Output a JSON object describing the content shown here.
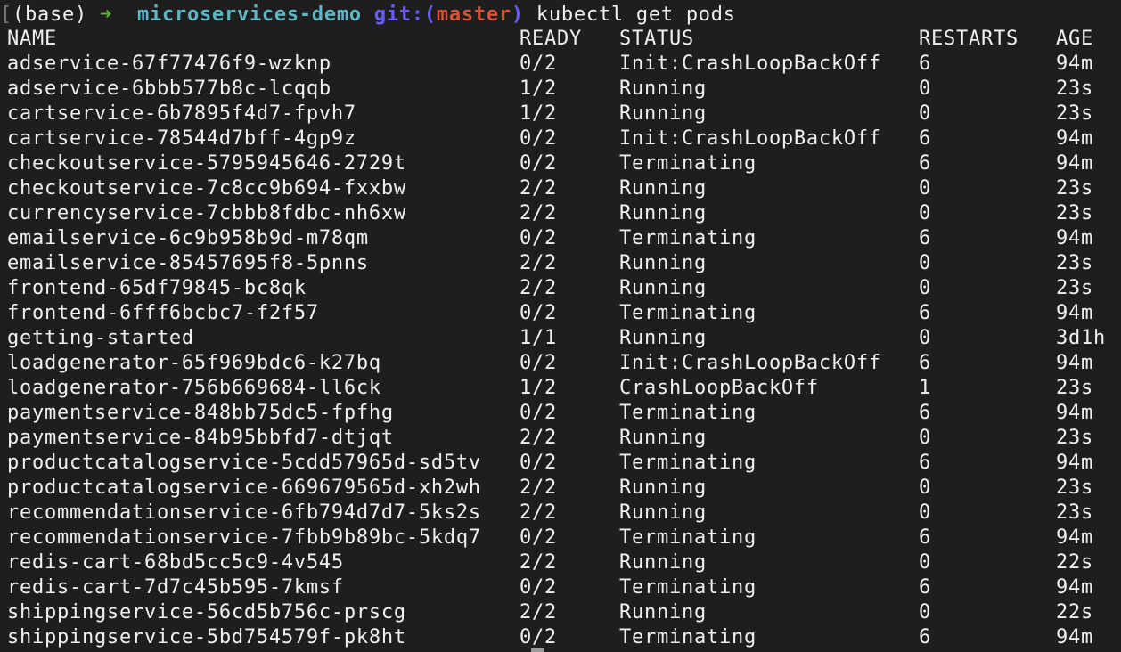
{
  "prompt": {
    "bracket": "[",
    "env": "(base)",
    "arrow": "➜",
    "directory": "microservices-demo",
    "git_prefix": "git:(",
    "branch": "master",
    "git_suffix": ")",
    "command": "kubectl get pods"
  },
  "colors": {
    "background": "#1e1e1e",
    "text": "#f0f0f0",
    "arrow": "#5fb236",
    "directory": "#5fb6c4",
    "git": "#6a5cff",
    "branch": "#d6533a"
  },
  "table": {
    "headers": [
      "NAME",
      "READY",
      "STATUS",
      "RESTARTS",
      "AGE"
    ],
    "rows": [
      [
        "adservice-67f77476f9-wzknp",
        "0/2",
        "Init:CrashLoopBackOff",
        "6",
        "94m"
      ],
      [
        "adservice-6bbb577b8c-lcqqb",
        "1/2",
        "Running",
        "0",
        "23s"
      ],
      [
        "cartservice-6b7895f4d7-fpvh7",
        "1/2",
        "Running",
        "0",
        "23s"
      ],
      [
        "cartservice-78544d7bff-4gp9z",
        "0/2",
        "Init:CrashLoopBackOff",
        "6",
        "94m"
      ],
      [
        "checkoutservice-5795945646-2729t",
        "0/2",
        "Terminating",
        "6",
        "94m"
      ],
      [
        "checkoutservice-7c8cc9b694-fxxbw",
        "2/2",
        "Running",
        "0",
        "23s"
      ],
      [
        "currencyservice-7cbbb8fdbc-nh6xw",
        "2/2",
        "Running",
        "0",
        "23s"
      ],
      [
        "emailservice-6c9b958b9d-m78qm",
        "0/2",
        "Terminating",
        "6",
        "94m"
      ],
      [
        "emailservice-85457695f8-5pnns",
        "2/2",
        "Running",
        "0",
        "23s"
      ],
      [
        "frontend-65df79845-bc8qk",
        "2/2",
        "Running",
        "0",
        "23s"
      ],
      [
        "frontend-6fff6bcbc7-f2f57",
        "0/2",
        "Terminating",
        "6",
        "94m"
      ],
      [
        "getting-started",
        "1/1",
        "Running",
        "0",
        "3d1h"
      ],
      [
        "loadgenerator-65f969bdc6-k27bq",
        "0/2",
        "Init:CrashLoopBackOff",
        "6",
        "94m"
      ],
      [
        "loadgenerator-756b669684-ll6ck",
        "1/2",
        "CrashLoopBackOff",
        "1",
        "23s"
      ],
      [
        "paymentservice-848bb75dc5-fpfhg",
        "0/2",
        "Terminating",
        "6",
        "94m"
      ],
      [
        "paymentservice-84b95bbfd7-dtjqt",
        "2/2",
        "Running",
        "0",
        "23s"
      ],
      [
        "productcatalogservice-5cdd57965d-sd5tv",
        "0/2",
        "Terminating",
        "6",
        "94m"
      ],
      [
        "productcatalogservice-669679565d-xh2wh",
        "2/2",
        "Running",
        "0",
        "23s"
      ],
      [
        "recommendationservice-6fb794d7d7-5ks2s",
        "2/2",
        "Running",
        "0",
        "23s"
      ],
      [
        "recommendationservice-7fbb9b89bc-5kdq7",
        "0/2",
        "Terminating",
        "6",
        "94m"
      ],
      [
        "redis-cart-68bd5cc5c9-4v545",
        "2/2",
        "Running",
        "0",
        "22s"
      ],
      [
        "redis-cart-7d7c45b595-7kmsf",
        "0/2",
        "Terminating",
        "6",
        "94m"
      ],
      [
        "shippingservice-56cd5b756c-prscg",
        "2/2",
        "Running",
        "0",
        "22s"
      ],
      [
        "shippingservice-5bd754579f-pk8ht",
        "0/2",
        "Terminating",
        "6",
        "94m"
      ]
    ]
  }
}
